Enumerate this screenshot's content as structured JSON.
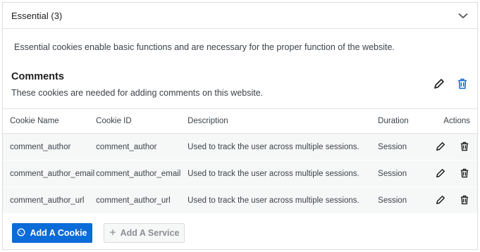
{
  "section": {
    "title": "Essential (3)",
    "description": "Essential cookies enable basic functions and are necessary for the proper function of the website."
  },
  "service": {
    "title": "Comments",
    "description": "These cookies are needed for adding comments on this website."
  },
  "table": {
    "headers": {
      "name": "Cookie Name",
      "id": "Cookie ID",
      "description": "Description",
      "duration": "Duration",
      "actions": "Actions"
    },
    "rows": [
      {
        "name": "comment_author",
        "id": "comment_author",
        "description": "Used to track the user across multiple sessions.",
        "duration": "Session"
      },
      {
        "name": "comment_author_email",
        "id": "comment_author_email",
        "description": "Used to track the user across multiple sessions.",
        "duration": "Session"
      },
      {
        "name": "comment_author_url",
        "id": "comment_author_url",
        "description": "Used to track the user across multiple sessions.",
        "duration": "Session"
      }
    ]
  },
  "buttons": {
    "add_cookie": "Add A Cookie",
    "add_service": "Add A Service"
  },
  "icons": {
    "collapse": "chevron-down-icon",
    "edit": "pencil-icon",
    "delete": "trash-icon",
    "cookie": "cookie-icon",
    "add": "plus-icon"
  },
  "colors": {
    "primary": "#0b6bd8",
    "row_background": "#f6f7f7",
    "delete_accent": "#0b6bd8"
  }
}
